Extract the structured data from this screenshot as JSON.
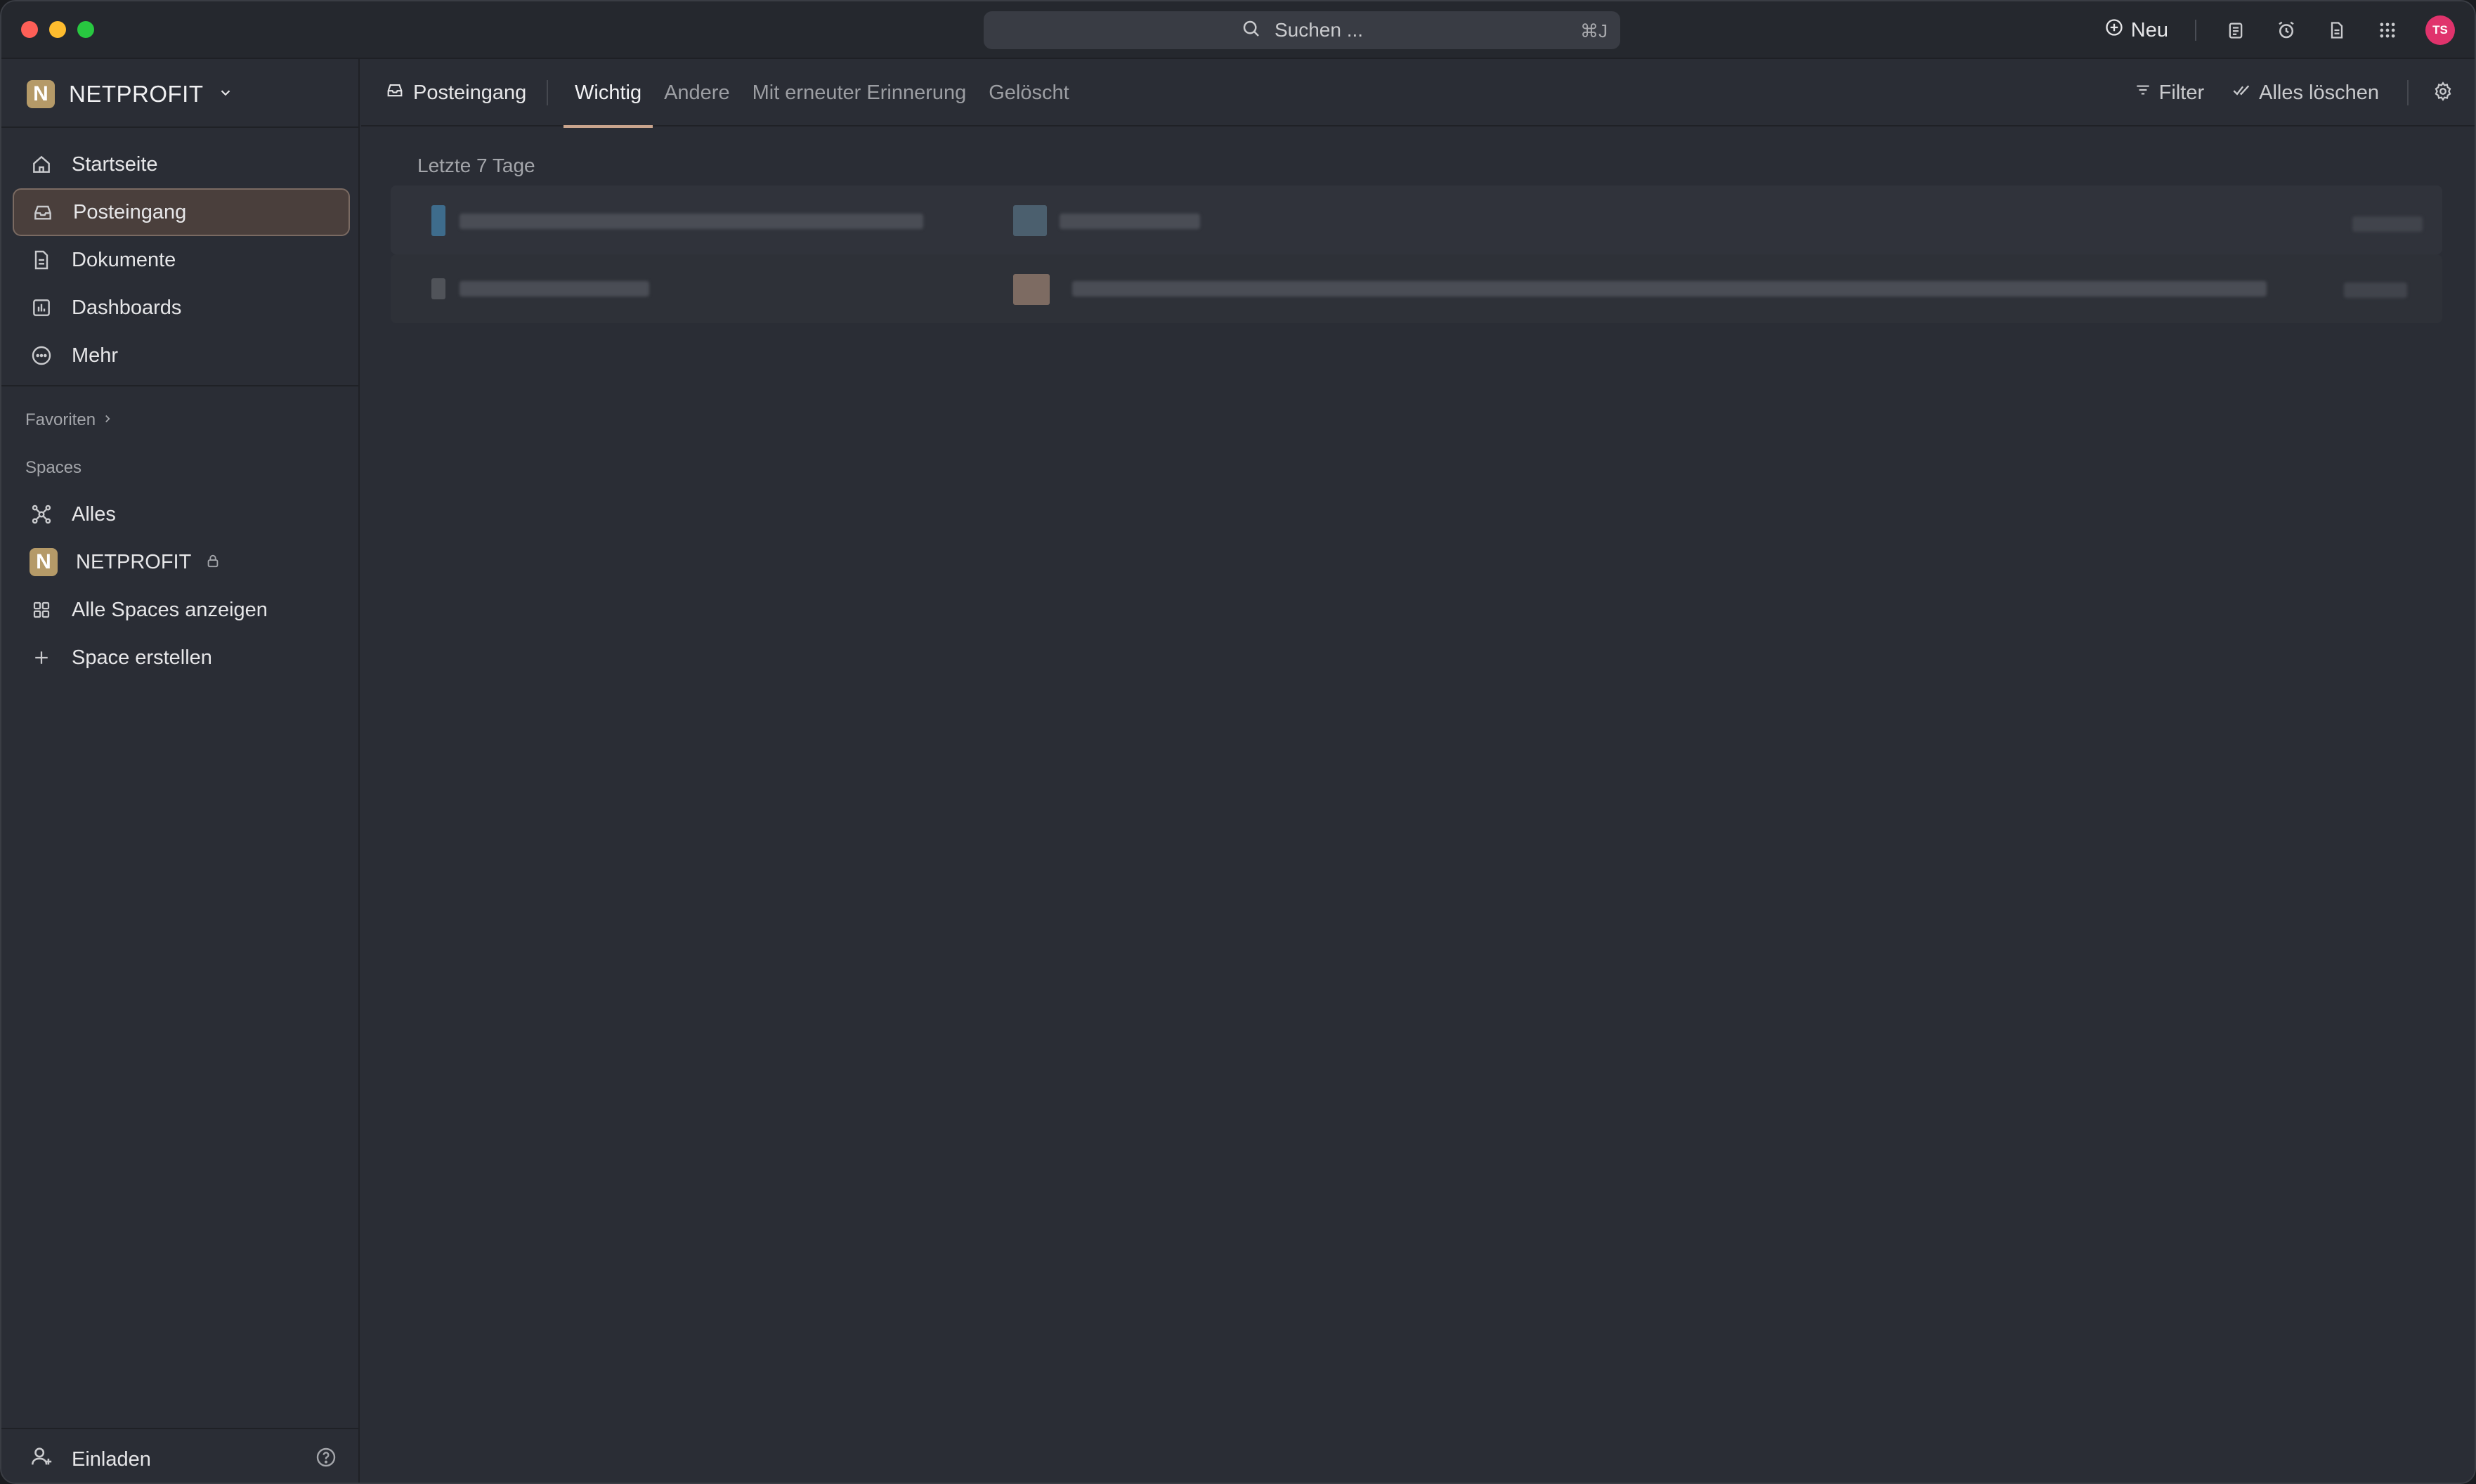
{
  "search": {
    "placeholder": "Suchen ...",
    "shortcut": "⌘J"
  },
  "topbar": {
    "new_label": "Neu",
    "user_initials": "TS",
    "icons": [
      "clipboard-icon",
      "alarm-icon",
      "document-icon",
      "apps-grid-icon"
    ]
  },
  "workspace": {
    "logo_letter": "N",
    "name": "NETPROFIT"
  },
  "nav": {
    "items": [
      {
        "label": "Startseite",
        "icon": "home-icon"
      },
      {
        "label": "Posteingang",
        "icon": "inbox-icon",
        "active": true
      },
      {
        "label": "Dokumente",
        "icon": "document-icon"
      },
      {
        "label": "Dashboards",
        "icon": "dashboard-icon"
      },
      {
        "label": "Mehr",
        "icon": "more-icon"
      }
    ]
  },
  "favorites_label": "Favoriten",
  "spaces": {
    "label": "Spaces",
    "items": [
      {
        "label": "Alles",
        "icon": "network-icon"
      },
      {
        "label": "NETPROFIT",
        "logo_letter": "N",
        "locked": true
      },
      {
        "label": "Alle Spaces anzeigen",
        "icon": "grid-icon"
      },
      {
        "label": "Space erstellen",
        "icon": "plus-icon"
      }
    ]
  },
  "footer": {
    "invite_label": "Einladen"
  },
  "inbox": {
    "label": "Posteingang",
    "tabs": [
      {
        "label": "Wichtig",
        "active": true
      },
      {
        "label": "Andere"
      },
      {
        "label": "Mit erneuter Erinnerung"
      },
      {
        "label": "Gelöscht"
      }
    ],
    "filter_label": "Filter",
    "clear_all_label": "Alles löschen",
    "section_title": "Letzte 7 Tage"
  },
  "colors": {
    "accent": "#c9a48d",
    "avatar": "#e0336c",
    "workspace_logo": "#b59a68",
    "background": "#2a2d35"
  }
}
